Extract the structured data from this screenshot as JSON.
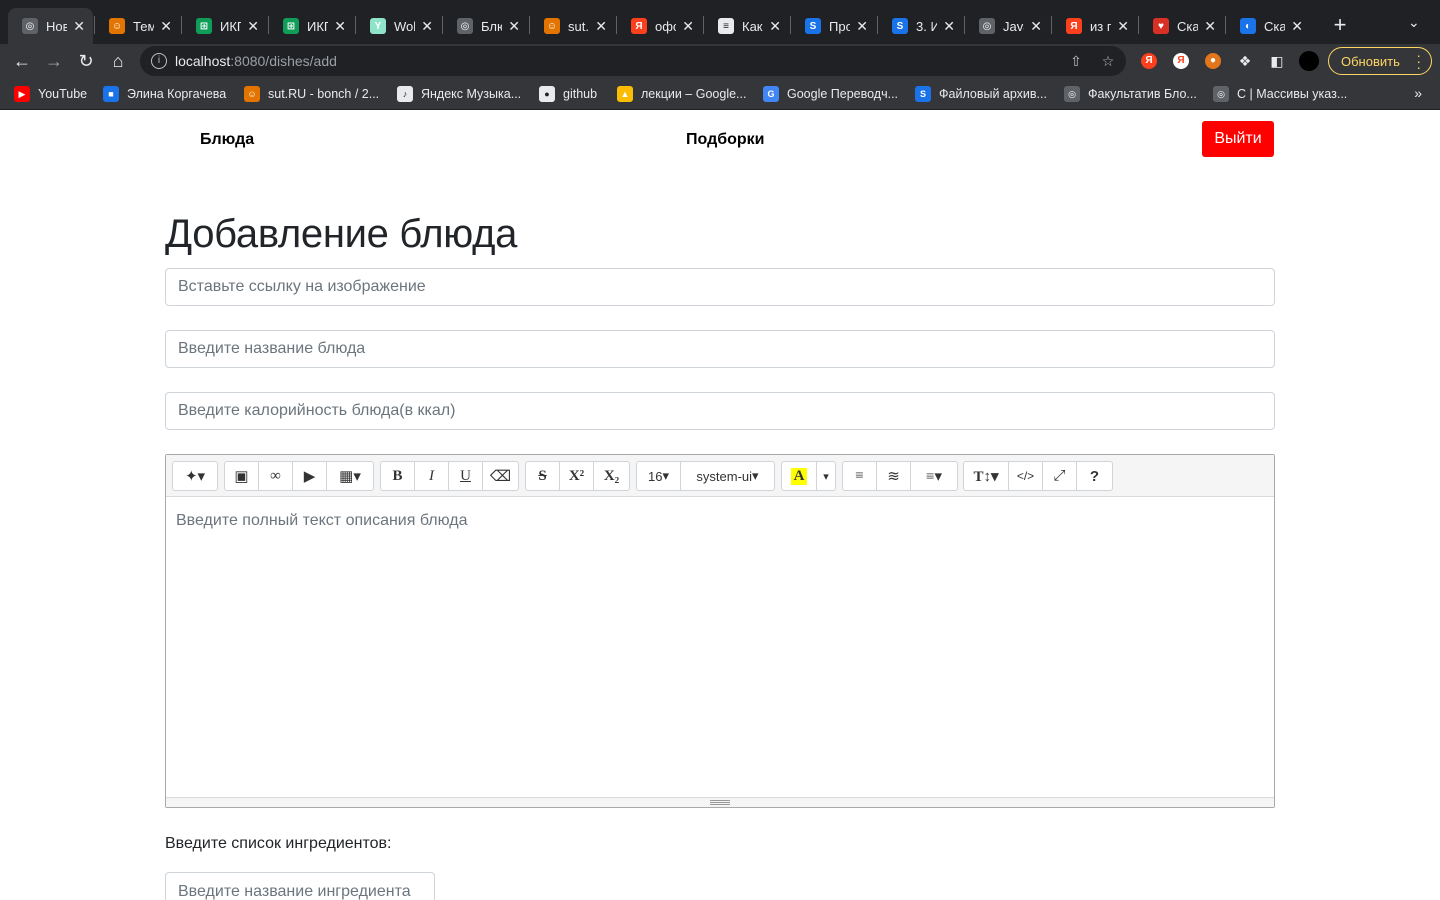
{
  "browser": {
    "tabs": [
      {
        "title": "Нов",
        "icon": "globe-icon",
        "color": "#5f6368",
        "active": true
      },
      {
        "title": "Тем",
        "icon": "contact-icon",
        "color": "#e37400"
      },
      {
        "title": "ИКГ",
        "icon": "sheets-icon",
        "color": "#0f9d58"
      },
      {
        "title": "ИКГ",
        "icon": "sheets-icon",
        "color": "#0f9d58"
      },
      {
        "title": "Wol",
        "icon": "y-icon",
        "color": "#8ee3c8"
      },
      {
        "title": "Блю",
        "icon": "globe-icon",
        "color": "#5f6368"
      },
      {
        "title": "sut.",
        "icon": "contact-icon",
        "color": "#e37400"
      },
      {
        "title": "офо",
        "icon": "yandex-icon",
        "color": "#fc3f1d"
      },
      {
        "title": "Как",
        "icon": "page-icon",
        "color": "#e8eaed"
      },
      {
        "title": "Про",
        "icon": "s-icon",
        "color": "#1a73e8"
      },
      {
        "title": "3. И",
        "icon": "s-icon",
        "color": "#1a73e8"
      },
      {
        "title": "Java",
        "icon": "globe-icon",
        "color": "#5f6368"
      },
      {
        "title": "из п",
        "icon": "yandex-icon",
        "color": "#fc3f1d"
      },
      {
        "title": "Ска",
        "icon": "heart-icon",
        "color": "#d93025"
      },
      {
        "title": "Ска",
        "icon": "earth-icon",
        "color": "#1a73e8"
      }
    ],
    "url_host": "localhost",
    "url_path": ":8080/dishes/add",
    "update_label": "Обновить",
    "bookmarks": [
      {
        "label": "YouTube",
        "icon": "youtube-icon",
        "color": "#ff0000"
      },
      {
        "label": "Элина Коргачева",
        "icon": "chat-icon",
        "color": "#1a73e8"
      },
      {
        "label": "sut.RU - bonch / 2...",
        "icon": "contact-icon",
        "color": "#e37400"
      },
      {
        "label": "Яндекс Музыка...",
        "icon": "music-icon",
        "color": "#e8eaed"
      },
      {
        "label": "github",
        "icon": "github-icon",
        "color": "#e8eaed"
      },
      {
        "label": "лекции – Google...",
        "icon": "drive-icon",
        "color": "#fbbc04"
      },
      {
        "label": "Google Переводч...",
        "icon": "translate-icon",
        "color": "#4285f4"
      },
      {
        "label": "Файловый архив...",
        "icon": "s-icon",
        "color": "#1a73e8"
      },
      {
        "label": "Факультатив Бло...",
        "icon": "globe-icon",
        "color": "#5f6368"
      },
      {
        "label": "С | Массивы указ...",
        "icon": "globe-icon",
        "color": "#5f6368"
      }
    ]
  },
  "nav": {
    "dishes": "Блюда",
    "collections": "Подборки",
    "logout": "Выйти"
  },
  "page": {
    "title": "Добавление блюда",
    "image_placeholder": "Вставьте ссылку на изображение",
    "name_placeholder": "Введите название блюда",
    "calories_placeholder": "Введите калорийность блюда(в ккал)",
    "description_placeholder": "Введите полный текст описания блюда",
    "ingredients_label": "Введите список ингредиентов:",
    "ingredient_placeholder": "Введите название ингредиента"
  },
  "editor": {
    "font_size": "16",
    "font_family": "system-ui",
    "highlight_color": "#ffff00"
  }
}
